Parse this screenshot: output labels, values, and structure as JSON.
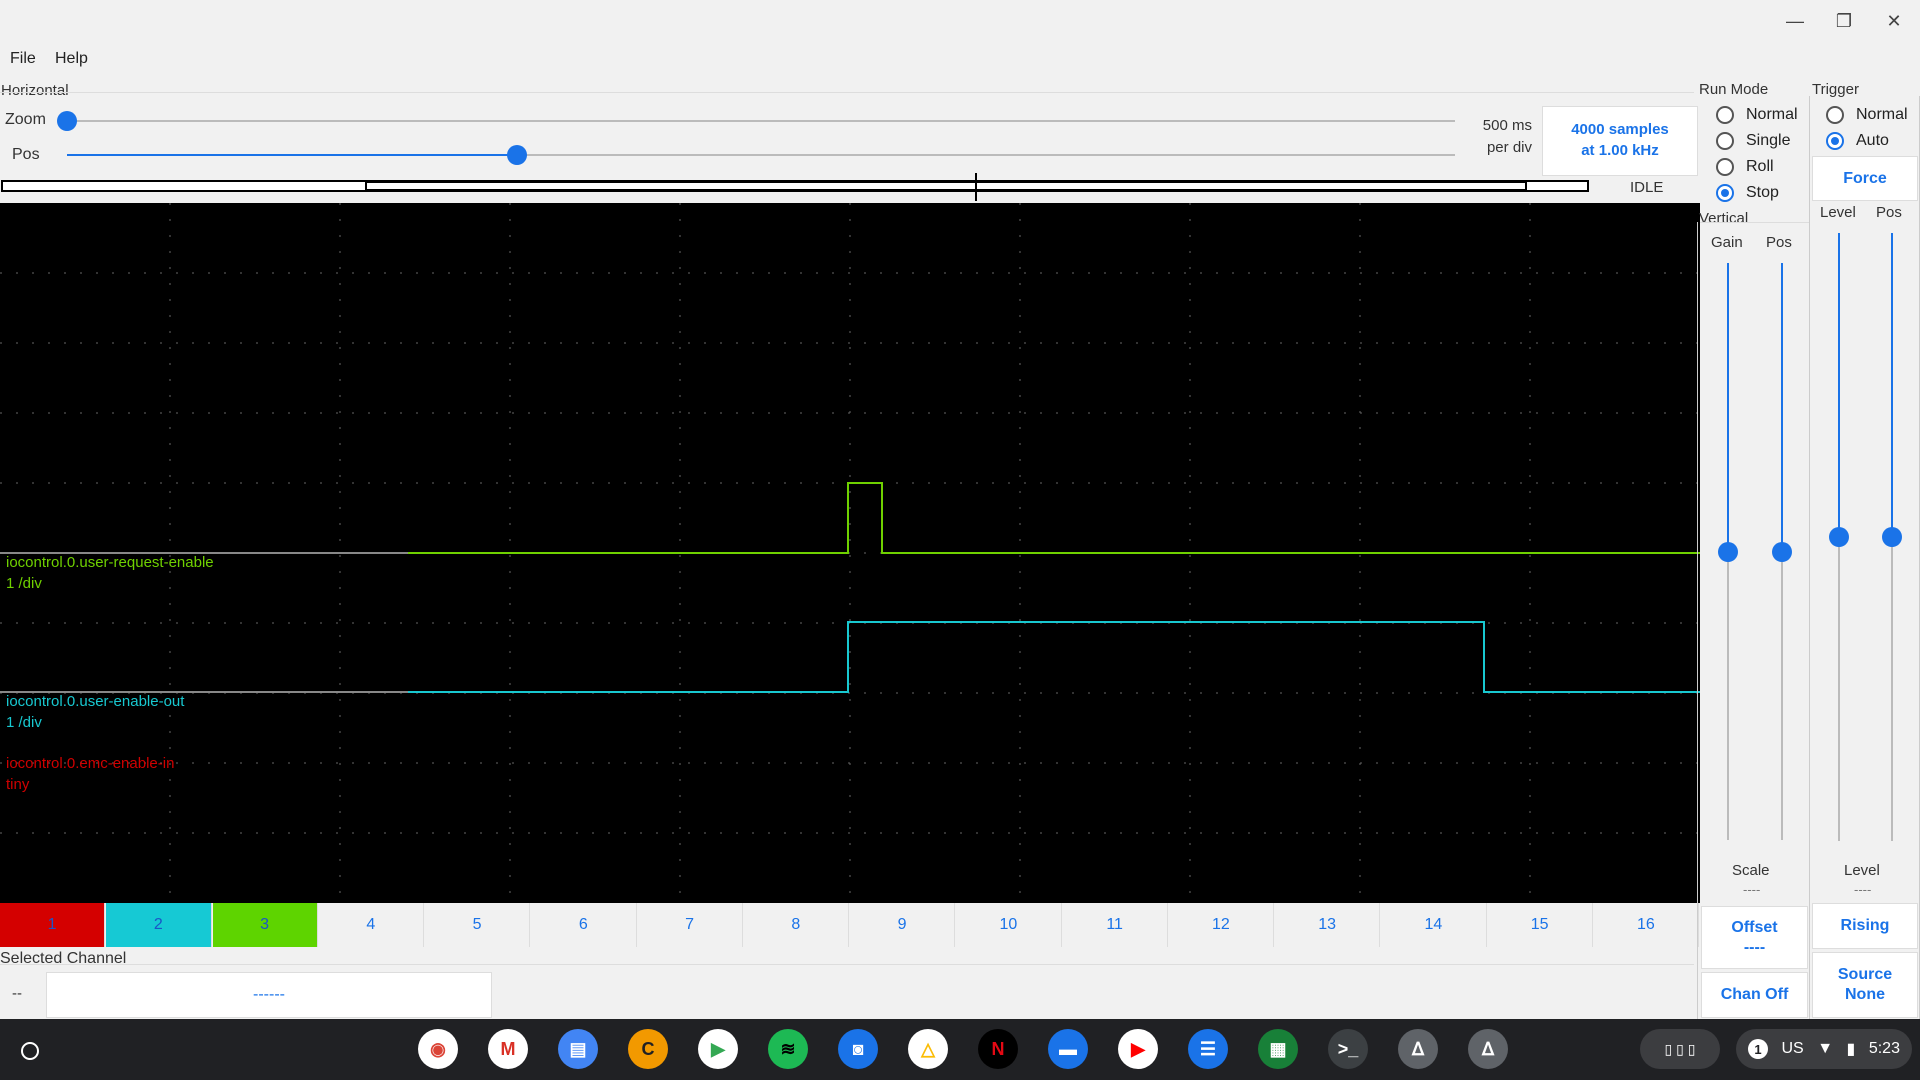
{
  "window": {
    "minimize": "—",
    "maximize": "❐",
    "close": "✕"
  },
  "menu": {
    "file": "File",
    "help": "Help"
  },
  "horizontal": {
    "title": "Horizontal",
    "zoom_label": "Zoom",
    "pos_label": "Pos",
    "per_div_value": "500 ms",
    "per_div_unit": "per div",
    "samples": "4000 samples",
    "rate": "at 1.00 kHz",
    "zoom_level": 0.0,
    "pos_level": 0.32,
    "status": "IDLE"
  },
  "run_mode": {
    "title": "Run Mode",
    "options": [
      "Normal",
      "Single",
      "Roll",
      "Stop"
    ],
    "selected": "Stop"
  },
  "trigger": {
    "title": "Trigger",
    "options": [
      "Normal",
      "Auto"
    ],
    "selected": "Auto",
    "force_label": "Force",
    "level_label": "Level",
    "pos_label": "Pos",
    "level_caption": "Level",
    "level_value": "----",
    "edge_label": "Rising",
    "source_label": "Source",
    "source_value": "None"
  },
  "vertical": {
    "title": "Vertical",
    "gain_label": "Gain",
    "pos_label": "Pos",
    "scale_label": "Scale",
    "scale_value": "----",
    "offset_label": "Offset",
    "offset_value": "----",
    "chan_off_label": "Chan Off"
  },
  "traces": [
    {
      "name": "iocontrol.0.user-request-enable",
      "scale": "1 /div",
      "color": "#6fd000"
    },
    {
      "name": "iocontrol.0.user-enable-out",
      "scale": "1 /div",
      "color": "#18c8d0"
    },
    {
      "name": "iocontrol.0.emc-enable-in",
      "scale": "tiny",
      "color": "#d00000"
    }
  ],
  "channels": [
    {
      "label": "1",
      "color": "#d40000"
    },
    {
      "label": "2",
      "color": "#16c9d4"
    },
    {
      "label": "3",
      "color": "#5ed400"
    },
    {
      "label": "4"
    },
    {
      "label": "5"
    },
    {
      "label": "6"
    },
    {
      "label": "7"
    },
    {
      "label": "8"
    },
    {
      "label": "9"
    },
    {
      "label": "10"
    },
    {
      "label": "11"
    },
    {
      "label": "12"
    },
    {
      "label": "13"
    },
    {
      "label": "14"
    },
    {
      "label": "15"
    },
    {
      "label": "16"
    }
  ],
  "selected_channel": {
    "title": "Selected Channel",
    "short": "--",
    "name": "------"
  },
  "taskbar": {
    "apps": [
      "chrome-icon",
      "gmail-icon",
      "docs-icon",
      "c-app-icon",
      "play-store-icon",
      "spotify-icon",
      "camera-icon",
      "drive-icon",
      "netflix-icon",
      "files-icon",
      "youtube-icon",
      "messages-icon",
      "sheets-icon",
      "terminal-icon",
      "penguin-icon",
      "penguin-icon-2"
    ],
    "notification_count": "1",
    "keyboard": "US",
    "time": "5:23"
  }
}
